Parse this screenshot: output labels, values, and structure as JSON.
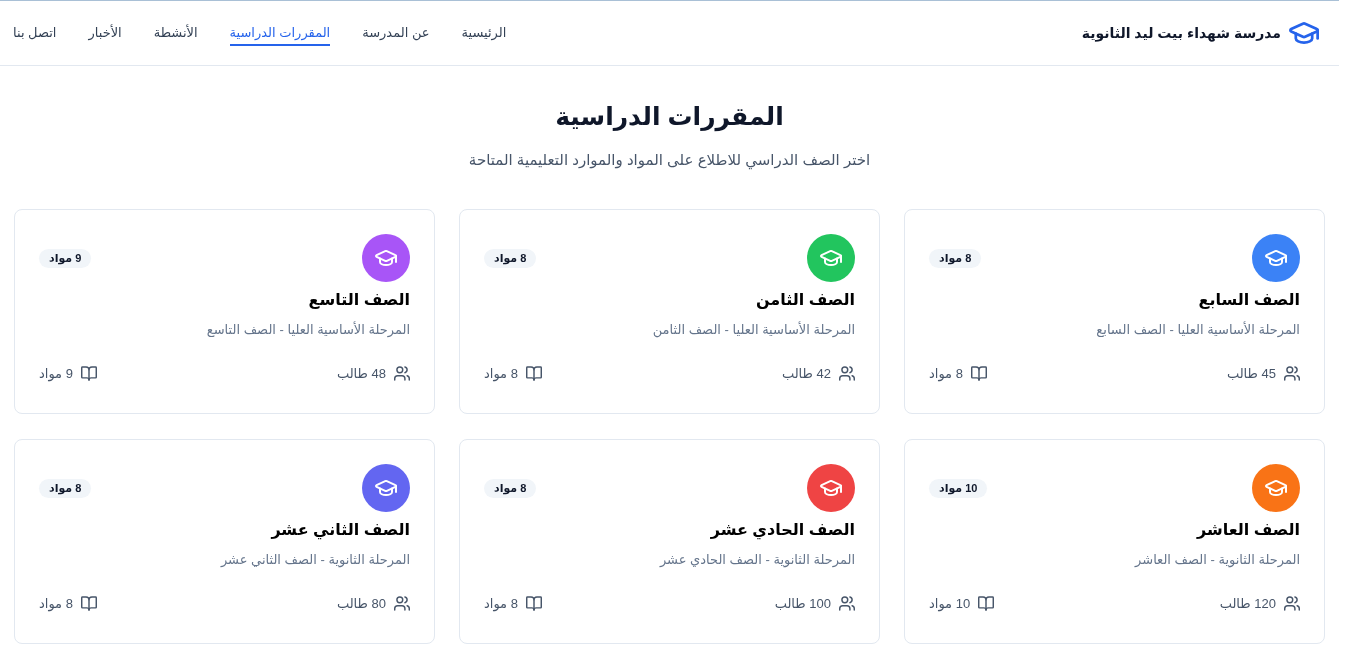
{
  "header": {
    "school_name": "مدرسة شهداء بيت ليد الثانوية",
    "nav": [
      {
        "label": "الرئيسية",
        "selected": false
      },
      {
        "label": "عن المدرسة",
        "selected": false
      },
      {
        "label": "المقررات الدراسية",
        "selected": true
      },
      {
        "label": "الأنشطة",
        "selected": false
      },
      {
        "label": "الأخبار",
        "selected": false
      },
      {
        "label": "اتصل بنا",
        "selected": false
      }
    ]
  },
  "page": {
    "title": "المقررات الدراسية",
    "subtitle": "اختر الصف الدراسي للاطلاع على المواد والموارد التعليمية المتاحة"
  },
  "grades": [
    {
      "name": "الصف السابع",
      "stage": "المرحلة الأساسية العليا - الصف السابع",
      "badge": "8 مواد",
      "students": "45 طالب",
      "subjects": "8 مواد",
      "color": "#3b82f6"
    },
    {
      "name": "الصف الثامن",
      "stage": "المرحلة الأساسية العليا - الصف الثامن",
      "badge": "8 مواد",
      "students": "42 طالب",
      "subjects": "8 مواد",
      "color": "#22c55e"
    },
    {
      "name": "الصف التاسع",
      "stage": "المرحلة الأساسية العليا - الصف التاسع",
      "badge": "9 مواد",
      "students": "48 طالب",
      "subjects": "9 مواد",
      "color": "#a855f7"
    },
    {
      "name": "الصف العاشر",
      "stage": "المرحلة الثانوية - الصف العاشر",
      "badge": "10 مواد",
      "students": "120 طالب",
      "subjects": "10 مواد",
      "color": "#f97316"
    },
    {
      "name": "الصف الحادي عشر",
      "stage": "المرحلة الثانوية - الصف الحادي عشر",
      "badge": "8 مواد",
      "students": "100 طالب",
      "subjects": "8 مواد",
      "color": "#ef4444"
    },
    {
      "name": "الصف الثاني عشر",
      "stage": "المرحلة الثانوية - الصف الثاني عشر",
      "badge": "8 مواد",
      "students": "80 طالب",
      "subjects": "8 مواد",
      "color": "#6366f1"
    }
  ]
}
